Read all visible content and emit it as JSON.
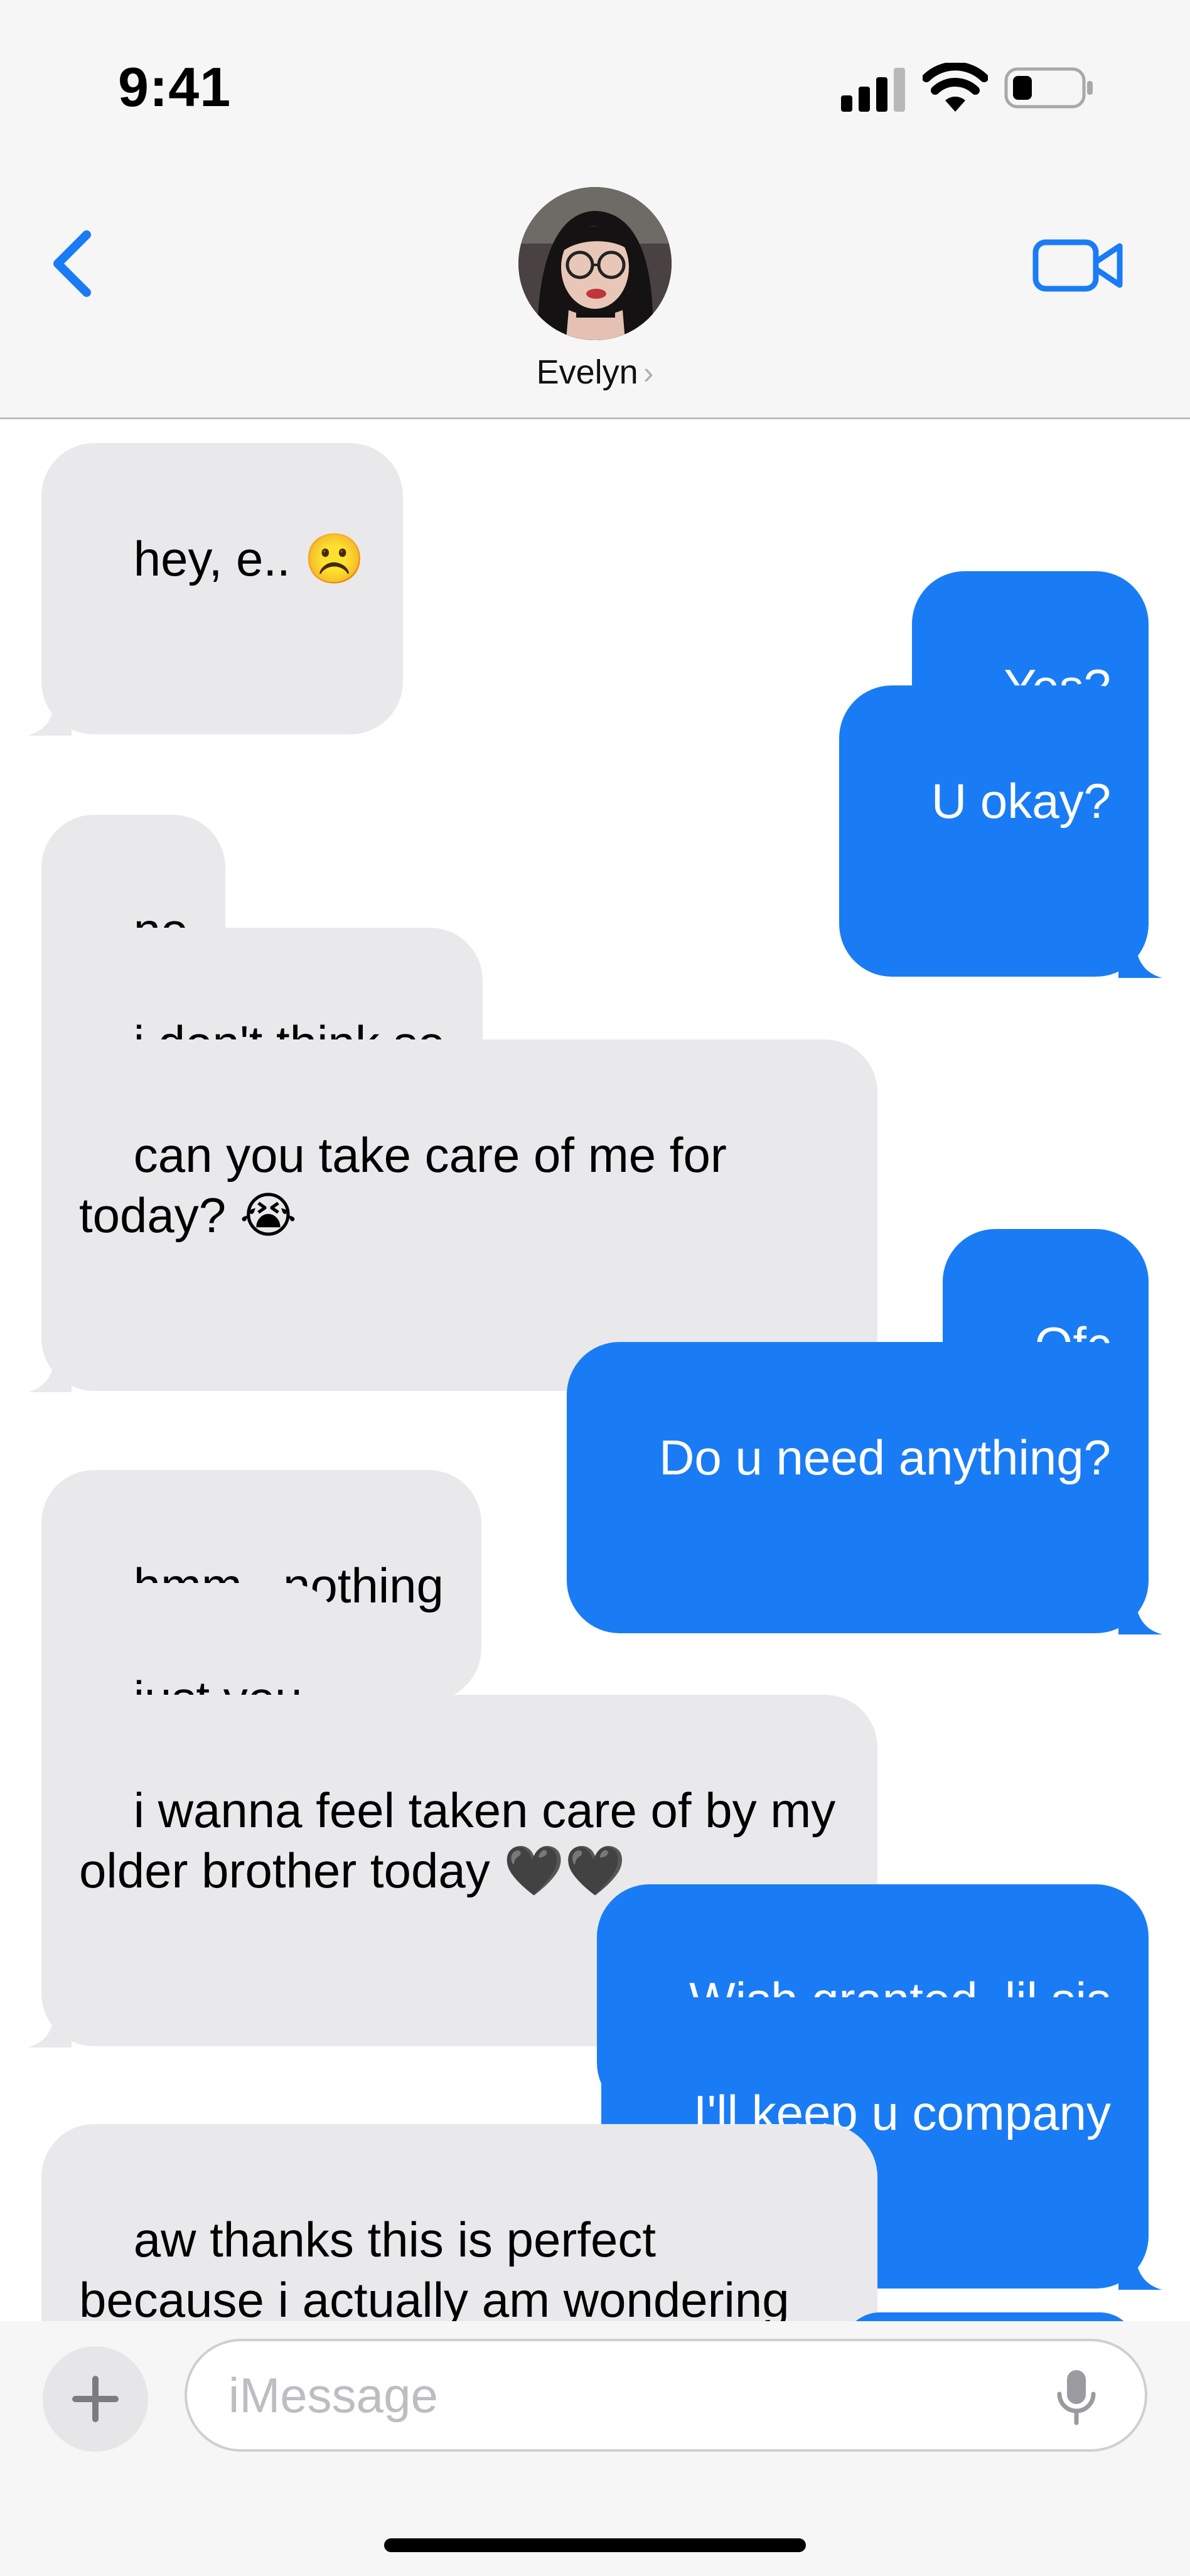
{
  "status_bar": {
    "time": "9:41"
  },
  "header": {
    "contact_name": "Evelyn",
    "contact_chevron": "›",
    "back_icon": "chevron-left",
    "video_icon": "video-camera"
  },
  "messages": [
    {
      "from": "them",
      "text": "hey, e.. ☹️"
    },
    {
      "from": "me",
      "text": "Yes?"
    },
    {
      "from": "me",
      "text": "U okay?"
    },
    {
      "from": "them",
      "text": "no"
    },
    {
      "from": "them",
      "text": "i don't think so"
    },
    {
      "from": "them",
      "text": "can you take care of me for\ntoday? 😭"
    },
    {
      "from": "me",
      "text": "Ofc"
    },
    {
      "from": "me",
      "text": "Do u need anything?"
    },
    {
      "from": "them",
      "text": "hmm.. nothing"
    },
    {
      "from": "them",
      "text": "just you"
    },
    {
      "from": "them",
      "text": "i wanna feel taken care of by my\nolder brother today 🖤🖤"
    },
    {
      "from": "me",
      "text": "Wish granted, lil sis"
    },
    {
      "from": "me",
      "text": "I'll keep u company"
    },
    {
      "from": "them",
      "text": "aw thanks this is perfect\nbecause i actually am wondering"
    }
  ],
  "composer": {
    "placeholder": "iMessage",
    "plus_label": "+"
  },
  "colors": {
    "incoming_bubble": "#e9e9eb",
    "outgoing_bubble": "#1a7cf5",
    "accent": "#1a7cf5"
  }
}
